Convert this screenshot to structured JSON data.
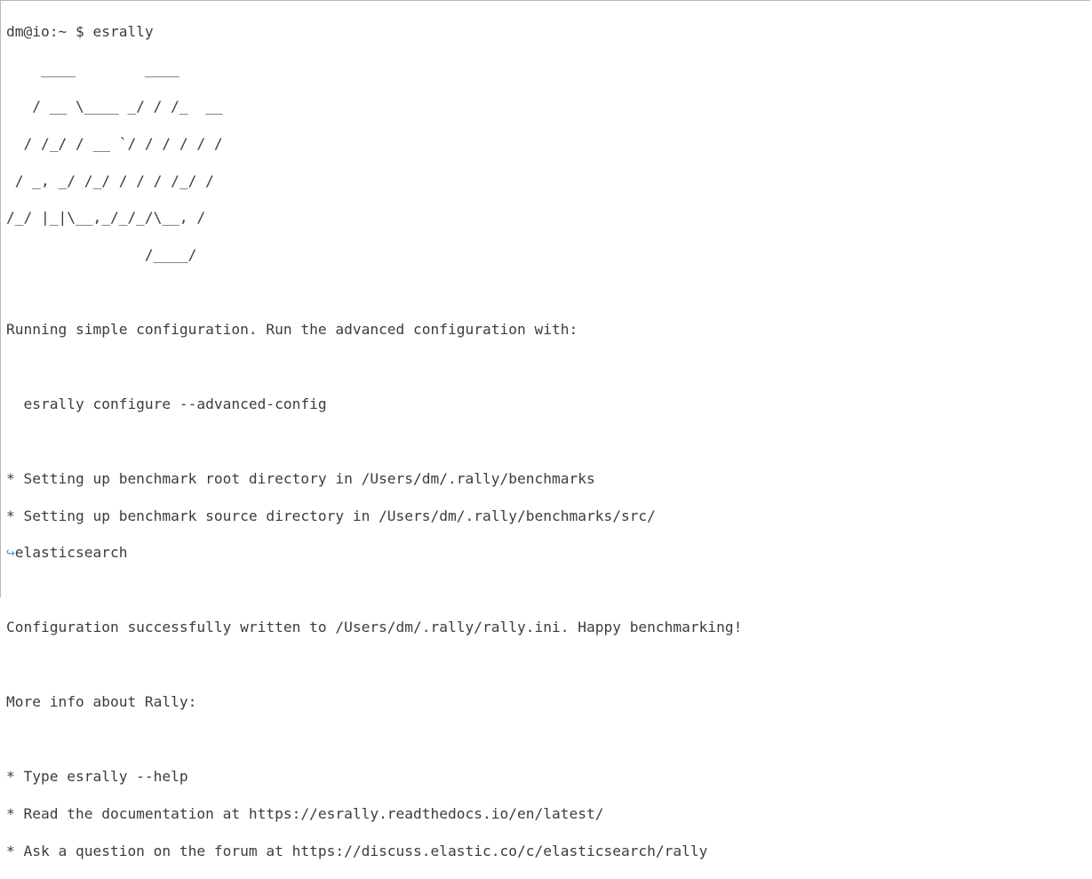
{
  "terminal": {
    "prompt_line": "dm@io:~ $ esrally",
    "banner": [
      "    ____        ____",
      "   / __ \\____ _/ / /_  __",
      "  / /_/ / __ `/ / / / / /",
      " / _, _/ /_/ / / / /_/ /",
      "/_/ |_|\\__,_/_/_/\\__, /",
      "                /____/"
    ],
    "running_msg": "Running simple configuration. Run the advanced configuration with:",
    "advanced_cmd": "  esrally configure --advanced-config",
    "setup_root": "* Setting up benchmark root directory in /Users/dm/.rally/benchmarks",
    "setup_source": "* Setting up benchmark source directory in /Users/dm/.rally/benchmarks/src/",
    "continuation_arrow": "↪",
    "setup_source_cont": "elasticsearch",
    "config_written": "Configuration successfully written to /Users/dm/.rally/rally.ini. Happy benchmarking!",
    "more_info": "More info about Rally:",
    "info_items": [
      "* Type esrally --help",
      "* Read the documentation at https://esrally.readthedocs.io/en/latest/",
      "* Ask a question on the forum at https://discuss.elastic.co/c/elasticsearch/rally"
    ]
  }
}
